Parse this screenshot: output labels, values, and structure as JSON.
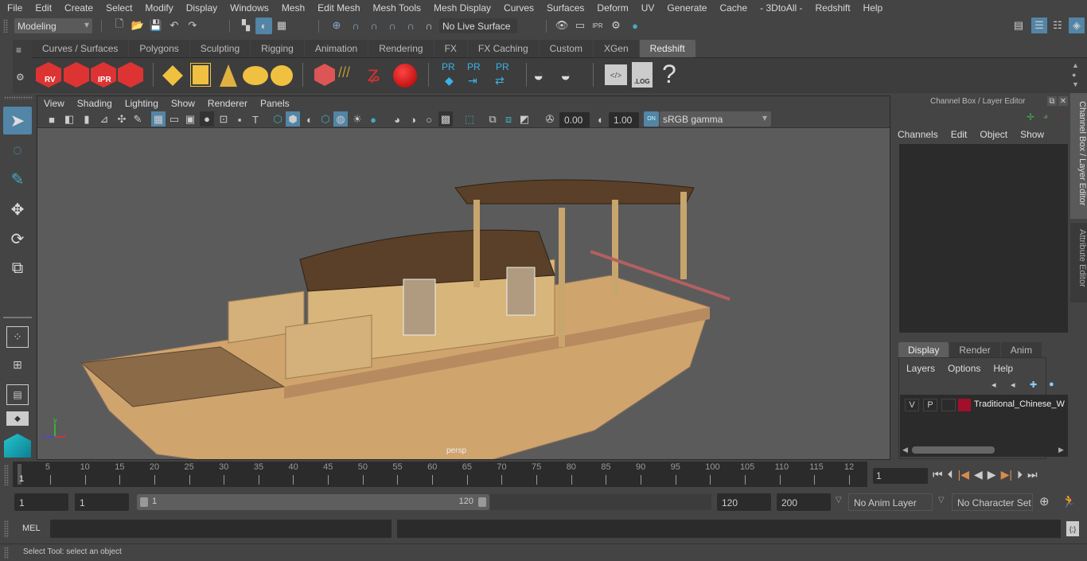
{
  "menubar": [
    "File",
    "Edit",
    "Create",
    "Select",
    "Modify",
    "Display",
    "Windows",
    "Mesh",
    "Edit Mesh",
    "Mesh Tools",
    "Mesh Display",
    "Curves",
    "Surfaces",
    "Deform",
    "UV",
    "Generate",
    "Cache",
    "- 3DtoAll -",
    "Redshift",
    "Help"
  ],
  "toolbar": {
    "mode": "Modeling",
    "live_surface": "No Live Surface"
  },
  "shelf": {
    "tabs": [
      "Curves / Surfaces",
      "Polygons",
      "Sculpting",
      "Rigging",
      "Animation",
      "Rendering",
      "FX",
      "FX Caching",
      "Custom",
      "XGen",
      "Redshift"
    ],
    "active_tab": "Redshift",
    "icons": [
      {
        "name": "redshift-render-view-icon",
        "label": "RV"
      },
      {
        "name": "redshift-batch-render-icon",
        "label": ""
      },
      {
        "name": "redshift-ipr-icon",
        "label": "IPR"
      },
      {
        "name": "redshift-settings-icon",
        "label": ""
      },
      {
        "name": "redshift-rectangle-light-icon",
        "label": ""
      },
      {
        "name": "redshift-portal-light-icon",
        "label": ""
      },
      {
        "name": "redshift-spot-light-icon",
        "label": ""
      },
      {
        "name": "redshift-dome-light-icon",
        "label": ""
      },
      {
        "name": "redshift-sun-sky-icon",
        "label": ""
      },
      {
        "name": "redshift-volume-icon",
        "label": ""
      },
      {
        "name": "redshift-hair-icon",
        "label": ""
      },
      {
        "name": "redshift-mesh-light-icon",
        "label": ""
      },
      {
        "name": "redshift-sphere-material-icon",
        "label": ""
      },
      {
        "name": "redshift-proxy-icon",
        "label": "PR"
      },
      {
        "name": "redshift-proxy-export-icon",
        "label": "PR"
      },
      {
        "name": "redshift-proxy-convert-icon",
        "label": "PR"
      },
      {
        "name": "redshift-bake-set-icon",
        "label": ""
      },
      {
        "name": "redshift-bake-icon",
        "label": ""
      },
      {
        "name": "redshift-script-icon",
        "label": ""
      },
      {
        "name": "redshift-log-icon",
        "label": ".LOG"
      },
      {
        "name": "help-icon",
        "label": "?"
      }
    ]
  },
  "viewport": {
    "menus": [
      "View",
      "Shading",
      "Lighting",
      "Show",
      "Renderer",
      "Panels"
    ],
    "exposure": "0.00",
    "gamma": "1.00",
    "color_space": "sRGB gamma",
    "camera_label": "persp",
    "axis": {
      "x": "x",
      "y": "y",
      "z": "z"
    }
  },
  "channel_box": {
    "title": "Channel Box / Layer Editor",
    "menus": [
      "Channels",
      "Edit",
      "Object",
      "Show"
    ]
  },
  "layer_editor": {
    "tabs": [
      "Display",
      "Render",
      "Anim"
    ],
    "active_tab": "Display",
    "menus": [
      "Layers",
      "Options",
      "Help"
    ],
    "layers": [
      {
        "v": "V",
        "p": "P",
        "color": "#a0102a",
        "name": "Traditional_Chinese_W"
      }
    ]
  },
  "side_tabs": [
    "Channel Box / Layer Editor",
    "Attribute Editor"
  ],
  "timeline": {
    "ticks": [
      "5",
      "10",
      "15",
      "20",
      "25",
      "30",
      "35",
      "40",
      "45",
      "50",
      "55",
      "60",
      "65",
      "70",
      "75",
      "80",
      "85",
      "90",
      "95",
      "100",
      "105",
      "110",
      "115",
      "12"
    ],
    "current_frame_marker": "1",
    "current_frame": "1"
  },
  "range": {
    "start": "1",
    "anim_start": "1",
    "slider_min": "1",
    "slider_max": "120",
    "end": "120",
    "anim_end": "200",
    "anim_layer": "No Anim Layer",
    "character_set": "No Character Set"
  },
  "command_line": {
    "label": "MEL"
  },
  "status": "Select Tool: select an object"
}
